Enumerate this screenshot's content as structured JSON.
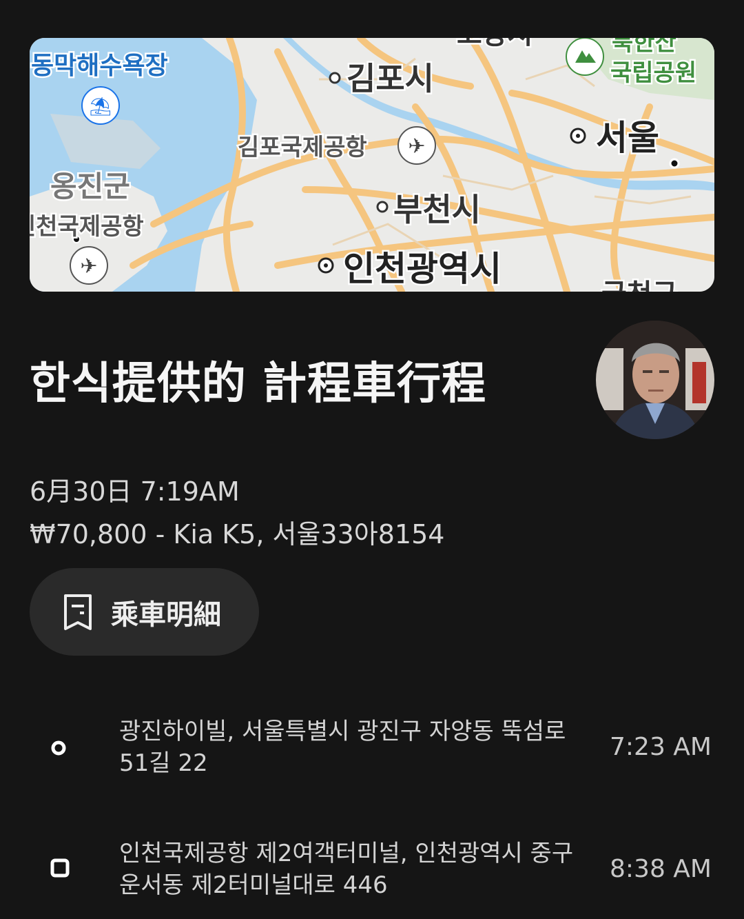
{
  "map": {
    "labels": {
      "beach": "동막해수욕장",
      "gimpo_city": "김포시",
      "park": "북한산\n국립공원",
      "gimpo_airport": "김포국제공항",
      "seoul": "서울",
      "ongjin": "옹진군",
      "incheon_airport": "인천국제공항",
      "bucheon": "부천시",
      "incheon": "인천광역시",
      "geumcheon": "금천구",
      "goyang": "고양시"
    }
  },
  "trip": {
    "title": "한식提供的 計程車行程",
    "datetime": "6月30日 7:19AM",
    "fare_vehicle": "₩70,800 - Kia K5, 서울33아8154",
    "receipt_label": "乘車明細"
  },
  "stops": [
    {
      "address": "광진하이빌, 서울특별시 광진구 자양동 뚝섬로 51길 22",
      "time": "7:23 AM",
      "marker": "pickup-circle"
    },
    {
      "address": "인천국제공항 제2여객터미널, 인천광역시 중구 운서동 제2터미널대로 446",
      "time": "8:38 AM",
      "marker": "dropoff-square"
    }
  ],
  "colors": {
    "background": "#151515",
    "road": "#f6c98a",
    "water": "#a8d2f0",
    "button": "#2a2a2a"
  }
}
